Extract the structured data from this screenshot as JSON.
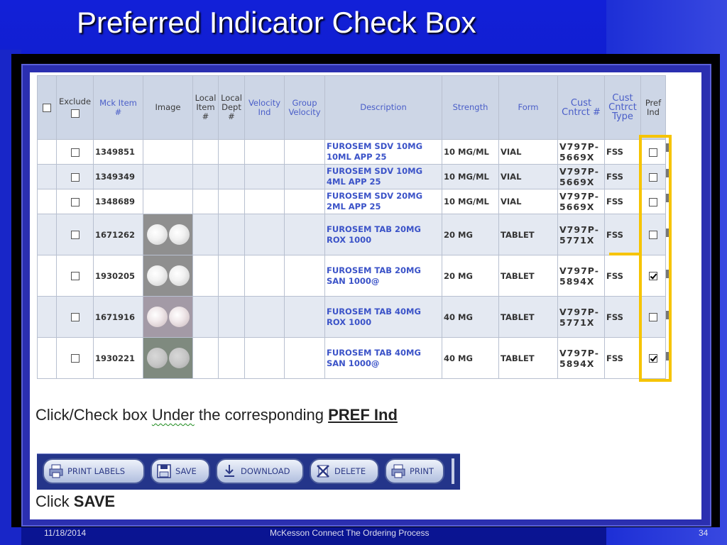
{
  "slide": {
    "title": "Preferred Indicator Check Box",
    "footer_date": "11/18/2014",
    "footer_center": "McKesson Connect The Ordering Process",
    "footer_page": "34"
  },
  "table": {
    "headers": {
      "exclude": "Exclude",
      "mck_item": "Mck Item #",
      "image": "Image",
      "local_item": "Local Item #",
      "local_dept": "Local Dept #",
      "velocity_ind": "Velocity Ind",
      "group_velocity": "Group Velocity",
      "description": "Description",
      "strength": "Strength",
      "form": "Form",
      "cust_contract_num": "Cust Cntrct #",
      "cust_contract_type": "Cust Cntrct Type",
      "pref_ind": "Pref Ind"
    },
    "rows": [
      {
        "item": "1349851",
        "desc1": "FUROSEM SDV 10MG",
        "desc2": "10ML APP 25",
        "strength": "10 MG/ML",
        "form": "VIAL",
        "contract1": "V797P-",
        "contract2": "5669X",
        "type": "FSS",
        "pref_checked": false,
        "image": ""
      },
      {
        "item": "1349349",
        "desc1": "FUROSEM SDV 10MG",
        "desc2": "4ML APP 25",
        "strength": "10 MG/ML",
        "form": "VIAL",
        "contract1": "V797P-",
        "contract2": "5669X",
        "type": "FSS",
        "pref_checked": false,
        "image": ""
      },
      {
        "item": "1348689",
        "desc1": "FUROSEM SDV 20MG",
        "desc2": "2ML APP 25",
        "strength": "10 MG/ML",
        "form": "VIAL",
        "contract1": "V797P-",
        "contract2": "5669X",
        "type": "FSS",
        "pref_checked": false,
        "image": ""
      },
      {
        "item": "1671262",
        "desc1": "FUROSEM TAB 20MG",
        "desc2": "ROX 1000",
        "strength": "20 MG",
        "form": "TABLET",
        "contract1": "V797P-",
        "contract2": "5771X",
        "type": "FSS",
        "pref_checked": false,
        "image": "white-tablets"
      },
      {
        "item": "1930205",
        "desc1": "FUROSEM TAB 20MG",
        "desc2": "SAN 1000@",
        "strength": "20 MG",
        "form": "TABLET",
        "contract1": "V797P-",
        "contract2": "5894X",
        "type": "FSS",
        "pref_checked": true,
        "image": "white-tablets"
      },
      {
        "item": "1671916",
        "desc1": "FUROSEM TAB 40MG",
        "desc2": "ROX 1000",
        "strength": "40 MG",
        "form": "TABLET",
        "contract1": "V797P-",
        "contract2": "5771X",
        "type": "FSS",
        "pref_checked": false,
        "image": "pink-tablets"
      },
      {
        "item": "1930221",
        "desc1": "FUROSEM TAB 40MG",
        "desc2": "SAN 1000@",
        "strength": "40 MG",
        "form": "TABLET",
        "contract1": "V797P-",
        "contract2": "5894X",
        "type": "FSS",
        "pref_checked": true,
        "image": "grey-tablets"
      }
    ]
  },
  "instructions": {
    "line1_a": "Click/Check box ",
    "line1_under": "Under",
    "line1_b": " the corresponding ",
    "line1_pref": "PREF Ind",
    "line2_a": "Click ",
    "line2_save": "SAVE"
  },
  "toolbar": {
    "print_labels": "PRINT LABELS",
    "save": "SAVE",
    "download": "DOWNLOAD",
    "delete": "DELETE",
    "print": "PRINT"
  },
  "colors": {
    "highlight": "#f6c400",
    "link_blue": "#3b53c8",
    "slide_blue": "#1220d8"
  }
}
